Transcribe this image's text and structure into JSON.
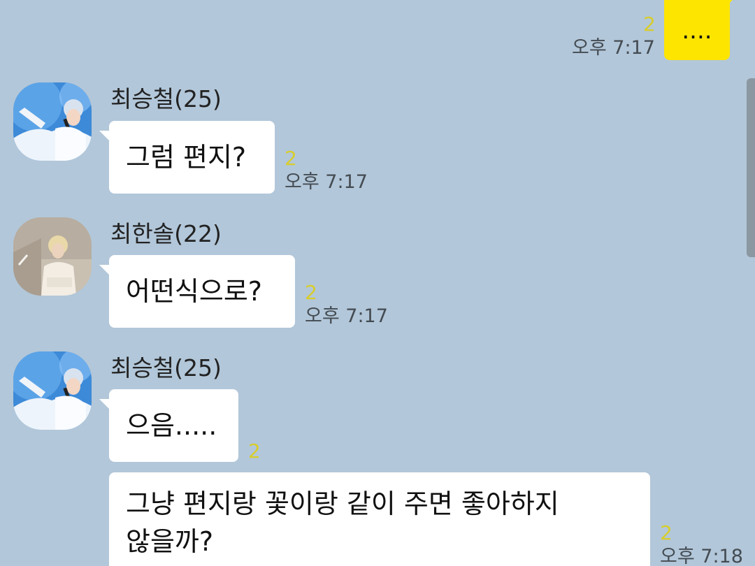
{
  "colors": {
    "background": "#b2c7d9",
    "my_bubble": "#fee500",
    "other_bubble": "#ffffff",
    "unread_count": "#d8cd2c",
    "scrollbar": "#8b97a1"
  },
  "messages": [
    {
      "from": "me",
      "text": "....",
      "unread": "2",
      "time": "오후 7:17"
    },
    {
      "from": "최승철(25)",
      "avatar": "stage-singer-avatar",
      "text": "그럼 편지?",
      "unread": "2",
      "time": "오후 7:17"
    },
    {
      "from": "최한솔(22)",
      "avatar": "sweater-portrait-avatar",
      "text": "어떤식으로?",
      "unread": "2",
      "time": "오후 7:17"
    },
    {
      "from": "최승철(25)",
      "avatar": "stage-singer-avatar",
      "text": "으음.....",
      "unread": "2",
      "time": ""
    },
    {
      "from": "최승철(25)",
      "text_line1": "그냥 편지랑 꽃이랑 같이 주면 좋아하지",
      "text_line2": "않을까?",
      "unread": "2",
      "time": "오후 7:18"
    }
  ]
}
